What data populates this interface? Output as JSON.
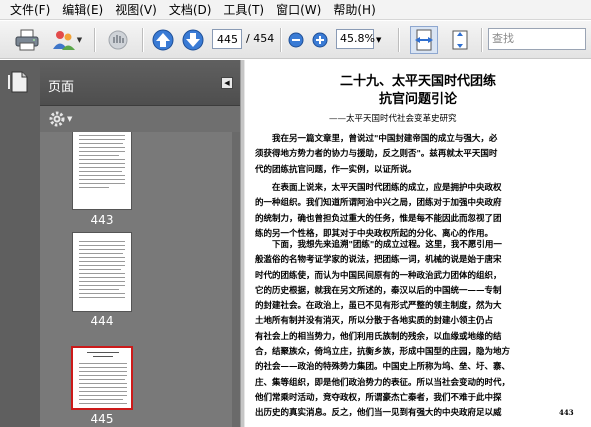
{
  "menu": [
    {
      "label": "文件(F)"
    },
    {
      "label": "编辑(E)"
    },
    {
      "label": "视图(V)"
    },
    {
      "label": "文档(D)"
    },
    {
      "label": "工具(T)"
    },
    {
      "label": "窗口(W)"
    },
    {
      "label": "帮助(H)"
    }
  ],
  "toolbar": {
    "current_page": "445",
    "page_total": "/ 454",
    "zoom": "45.8%",
    "search_placeholder": "查找"
  },
  "panel": {
    "title": "页面",
    "thumbnails": [
      {
        "label": "443",
        "selected": false
      },
      {
        "label": "444",
        "selected": false
      },
      {
        "label": "445",
        "selected": true
      }
    ]
  },
  "document": {
    "title_line1": "二十九、太平天国时代团练",
    "title_line2": "抗官问题引论",
    "subtitle": "——太平天国时代社会变革史研究",
    "paragraphs": [
      "　　我在另一篇文章里，曾说过\"中国封建帝国的成立与强大，必\n须获得地方势力者的协力与援助，反之则否\"。兹再就太平天国时\n代的团练抗官问题，作一实例，以证所说。",
      "　　在表面上说来，太平天国时代团练的成立，应是拥护中央政权\n的一种组织。我们知道所谓阿治中兴之局，团练对于加强中央政府\n的统制力，确也曾担负过重大的任务，惟是每不能因此而忽视了团\n练的另一个性格，即其对于中央政权所起的分化、离心的作用。",
      "　　下面，我想先来追溯\"团练\"的成立过程。这里，我不愿引用一\n般滥俗的名物考证学家的说法，把团练一词，机械的说是始于唐宋\n时代的团练使，而认为中国民间原有的一种政治武力团体的组织，\n它的历史根据，就我在另文所述的，秦汉以后的中国统一——专制\n的封建社会。在政治上，虽已不见有形式严整的领主制度，然为大\n土地所有制并没有消灭，所以分散于各地实质的封建小领主仍占\n有社会上的相当势力，他们利用氏族制的残余，以血缘或地缘的结\n合，结聚族众，倚坞立庄，抗衡乡族，形成中国型的庄园，隐为地方\n的社会——政治的特殊势力集团。中国史上所称为坞、垒、圩、寨、\n庄、集等组织，即是他们政治势力的表征。所以当社会变动的时代，\n他们常乘时活动，竞夺政权，所谓豪杰亡秦者，我们不难于此中探\n出历史的真实消息。反之，他们当一见到有强大的中央政府足以威"
    ],
    "page_number": "443"
  }
}
